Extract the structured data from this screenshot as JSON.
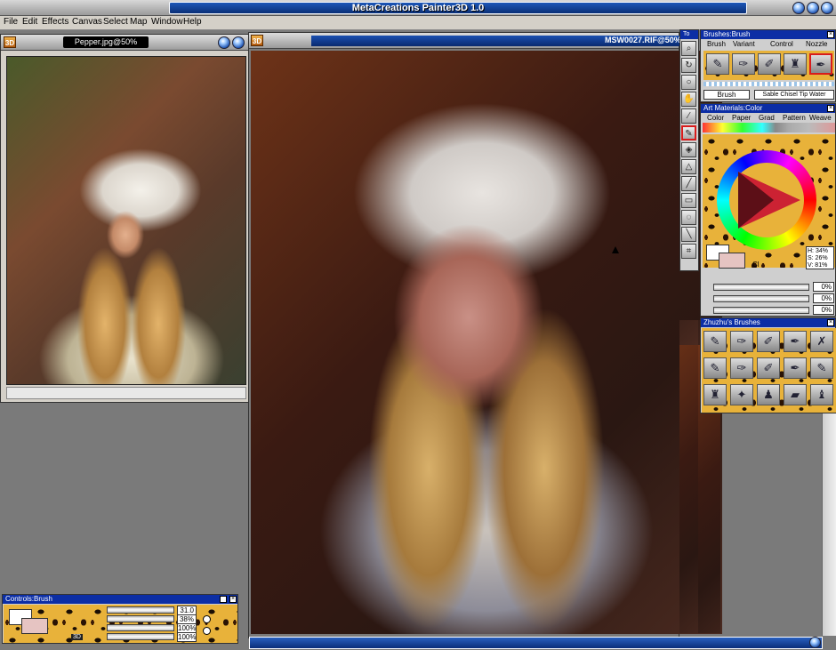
{
  "app": {
    "title": "MetaCreations Painter3D 1.0"
  },
  "menu": [
    "File",
    "Edit",
    "Effects",
    "Canvas",
    "Select",
    "Map",
    "Window",
    "Help"
  ],
  "doc_small": {
    "title": "Pepper.jpg@50%",
    "icon": "3D"
  },
  "doc_main": {
    "title": "MSW0027.RIF@50%",
    "icon": "3D"
  },
  "toolbox": {
    "title": "To"
  },
  "brushes_panel": {
    "title": "Brushes:Brush",
    "tabs": [
      "Brush",
      "Variant",
      "Control",
      "Nozzle"
    ],
    "selected_brush": "Brush",
    "selected_variant": "Sable Chisel Tip Water"
  },
  "art_materials": {
    "title": "Art Materials:Color",
    "tabs": [
      "Color",
      "Paper",
      "Grad",
      "Pattern",
      "Weave"
    ],
    "hsv": {
      "h": "H: 34%",
      "s": "S: 26%",
      "v": "V: 81%"
    },
    "clone_label": "Cl",
    "slider_values": [
      "0%",
      "0%",
      "0%"
    ],
    "primary_color": "#e6c4c2",
    "secondary_color": "#ffffff"
  },
  "zhuzhu": {
    "title": "Zhuzhu's Brushes"
  },
  "controls": {
    "title": "Controls:Brush",
    "values": [
      "31.0",
      "38%",
      "100%",
      "100%"
    ],
    "labels": [
      "3D"
    ]
  },
  "colors": {
    "titlebar_blue": "#0c2ea5",
    "selected_red": "#d81c1c"
  }
}
